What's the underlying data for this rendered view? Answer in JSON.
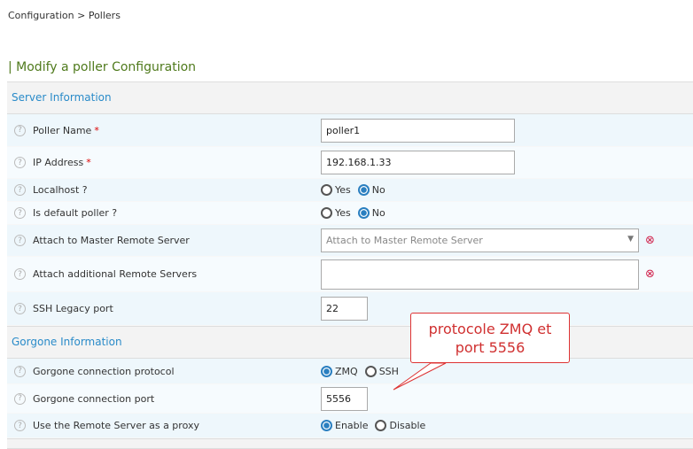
{
  "breadcrumb": {
    "items": [
      "Configuration",
      "Pollers"
    ],
    "sep": ">"
  },
  "page_title": "| Modify a poller Configuration",
  "sections": [
    {
      "title": "Server Information"
    },
    {
      "title": "Gorgone Information"
    }
  ],
  "fields": {
    "poller_name": {
      "label": "Poller Name",
      "value": "poller1"
    },
    "ip": {
      "label": "IP Address",
      "value": "192.168.1.33"
    },
    "localhost": {
      "label": "Localhost ?",
      "yes": "Yes",
      "no": "No",
      "selected": "No"
    },
    "default": {
      "label": "Is default poller ?",
      "yes": "Yes",
      "no": "No",
      "selected": "No"
    },
    "master": {
      "label": "Attach to Master Remote Server",
      "placeholder": "Attach to Master Remote Server"
    },
    "additional": {
      "label": "Attach additional Remote Servers",
      "value": ""
    },
    "ssh": {
      "label": "SSH Legacy port",
      "value": "22"
    },
    "protocol": {
      "label": "Gorgone connection protocol",
      "opt1": "ZMQ",
      "opt2": "SSH",
      "selected": "ZMQ"
    },
    "port": {
      "label": "Gorgone connection port",
      "value": "5556"
    },
    "proxy": {
      "label": "Use the Remote Server as a proxy",
      "opt1": "Enable",
      "opt2": "Disable",
      "selected": "Enable"
    }
  },
  "required_mark": "*",
  "callout": {
    "line1": "protocole ZMQ et",
    "line2": "port 5556"
  },
  "colors": {
    "title": "#4f7a1c",
    "section": "#2a8bc9",
    "annotation": "#d03030"
  }
}
